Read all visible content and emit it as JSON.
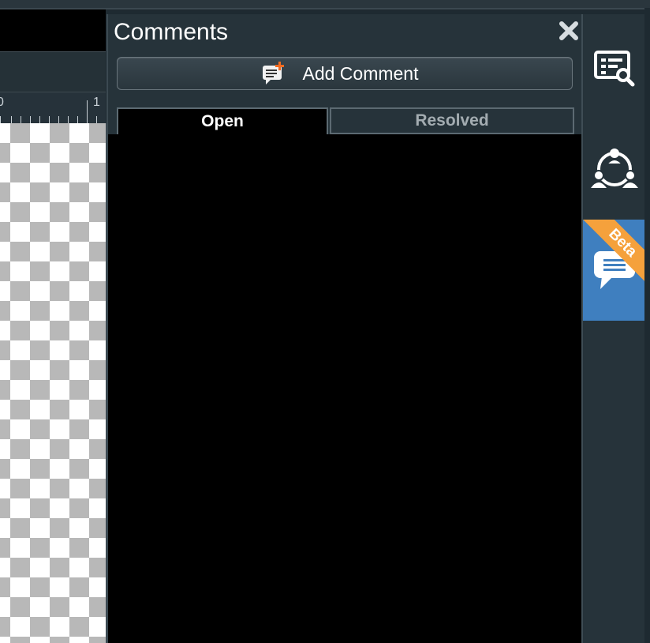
{
  "panel": {
    "title": "Comments",
    "add_button_label": "Add Comment",
    "tabs": [
      {
        "label": "Open",
        "active": true
      },
      {
        "label": "Resolved",
        "active": false
      }
    ]
  },
  "ruler": {
    "labels": [
      "0",
      "1"
    ]
  },
  "rail": {
    "items": [
      {
        "name": "inspector",
        "icon": "list-search-icon"
      },
      {
        "name": "collaboration",
        "icon": "people-network-icon"
      },
      {
        "name": "comments",
        "icon": "chat-bubble-icon",
        "badge": "Beta",
        "active": true
      }
    ]
  },
  "colors": {
    "accent": "#3f7fbf",
    "beta_badge": "#f5a13c",
    "panel_bg": "#26333a"
  }
}
